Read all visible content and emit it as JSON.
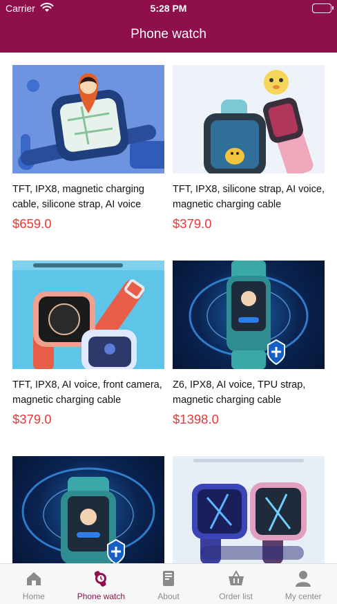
{
  "status": {
    "carrier": "Carrier",
    "time": "5:28 PM"
  },
  "header": {
    "title": "Phone watch"
  },
  "products": [
    {
      "desc": "TFT, IPX8, magnetic charging cable, silicone strap, AI voice",
      "price": "$659.0"
    },
    {
      "desc": "TFT, IPX8, silicone strap, AI voice, magnetic charging cable",
      "price": "$379.0"
    },
    {
      "desc": "TFT, IPX8, AI voice, front camera, magnetic charging cable",
      "price": "$379.0"
    },
    {
      "desc": "Z6, IPX8, AI voice, TPU strap, magnetic charging cable",
      "price": "$1398.0"
    },
    {
      "desc": "",
      "price": ""
    },
    {
      "desc": "",
      "price": ""
    }
  ],
  "tabs": [
    {
      "label": "Home",
      "icon": "home-icon"
    },
    {
      "label": "Phone watch",
      "icon": "watch-icon"
    },
    {
      "label": "About",
      "icon": "about-icon"
    },
    {
      "label": "Order list",
      "icon": "basket-icon"
    },
    {
      "label": "My center",
      "icon": "user-icon"
    }
  ],
  "colors": {
    "brand": "#8e0f4c",
    "price": "#e53935",
    "tab_inactive": "#8a8a8a"
  }
}
